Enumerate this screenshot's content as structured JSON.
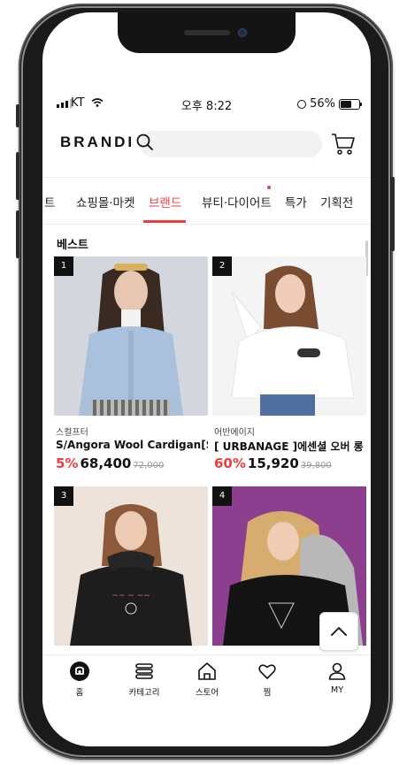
{
  "status_bar": {
    "carrier": "KT",
    "time": "오후 8:22",
    "battery": "56%"
  },
  "header": {
    "logo": "BRANDI"
  },
  "tabs": [
    {
      "label": "트"
    },
    {
      "label": "쇼핑몰·마켓"
    },
    {
      "label": "브랜드",
      "active": true
    },
    {
      "label": "뷰티·다이어트"
    },
    {
      "label": "특가"
    },
    {
      "label": "기획전"
    }
  ],
  "section": {
    "title": "베스트"
  },
  "products": [
    {
      "rank": "1",
      "store": "스컬프터",
      "name": "S/Angora Wool Cardigan[SK...",
      "discount": "5%",
      "price": "68,400",
      "original": "72,000"
    },
    {
      "rank": "2",
      "store": "어반에이지",
      "name": "[ URBANAGE ]에센셜 오버 롱 슬...",
      "discount": "60%",
      "price": "15,920",
      "original": "39,800"
    },
    {
      "rank": "3"
    },
    {
      "rank": "4"
    }
  ],
  "bottom_nav": [
    {
      "label": "홈",
      "icon": "home-logo-icon"
    },
    {
      "label": "카테고리",
      "icon": "category-icon"
    },
    {
      "label": "스토어",
      "icon": "store-icon"
    },
    {
      "label": "찜",
      "icon": "heart-icon"
    },
    {
      "label": "MY",
      "icon": "user-icon"
    }
  ],
  "colors": {
    "accent": "#ee3d3d",
    "text": "#111111",
    "search_bg": "#f2f2f2"
  }
}
